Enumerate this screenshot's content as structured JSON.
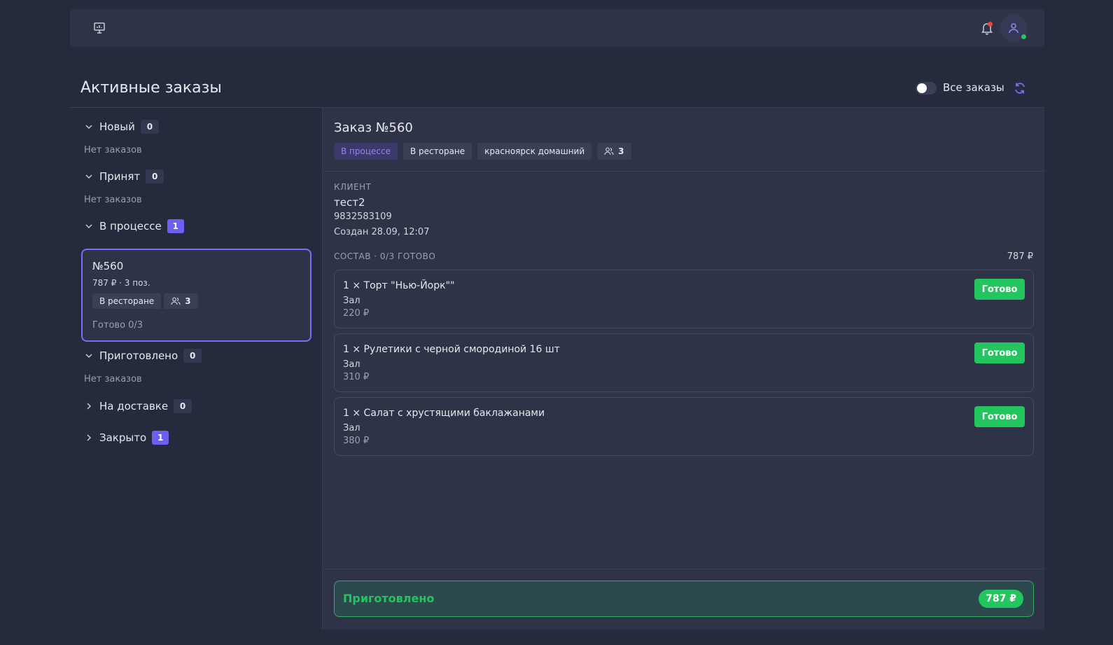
{
  "header": {
    "page_title": "Активные заказы",
    "all_orders_label": "Все заказы"
  },
  "groups": [
    {
      "label": "Новый",
      "count": "0",
      "empty_text": "Нет заказов",
      "expanded": true
    },
    {
      "label": "Принят",
      "count": "0",
      "empty_text": "Нет заказов",
      "expanded": true
    },
    {
      "label": "В процессе",
      "count": "1",
      "expanded": true
    },
    {
      "label": "Приготовлено",
      "count": "0",
      "empty_text": "Нет заказов",
      "expanded": true
    },
    {
      "label": "На доставке",
      "count": "0",
      "expanded": false
    },
    {
      "label": "Закрыто",
      "count": "1",
      "expanded": false
    }
  ],
  "order_card": {
    "number": "№560",
    "meta": "787 ₽ · 3 поз.",
    "type_tag": "В ресторане",
    "guests": "3",
    "ready": "Готово 0/3"
  },
  "detail": {
    "title": "Заказ №560",
    "status_tag": "В процессе",
    "type_tag": "В ресторане",
    "location_tag": "красноярск домашний",
    "guests": "3",
    "client_label": "КЛИЕНТ",
    "client_name": "тест2",
    "client_phone": "9832583109",
    "created": "Создан 28.09, 12:07",
    "composition_label": "СОСТАВ · 0/3 ГОТОВО",
    "composition_total": "787 ₽",
    "items": [
      {
        "name": "1 × Торт \"Нью-Йорк\"\"",
        "place": "Зал",
        "price": "220 ₽",
        "button": "Готово"
      },
      {
        "name": "1 × Рулетики с черной смородиной 16 шт",
        "place": "Зал",
        "price": "310 ₽",
        "button": "Готово"
      },
      {
        "name": "1 × Салат с хрустящими баклажанами",
        "place": "Зал",
        "price": "380 ₽",
        "button": "Готово"
      }
    ],
    "footer_status": "Приготовлено",
    "footer_total": "787 ₽"
  },
  "colors": {
    "accent": "#7c6cf6",
    "success": "#22c55e",
    "background": "#252a3d",
    "panel": "#2e3347"
  },
  "icons": [
    "monitor-icon",
    "bell-icon",
    "user-icon",
    "refresh-icon",
    "chevron-down-icon",
    "chevron-right-icon",
    "users-icon"
  ]
}
